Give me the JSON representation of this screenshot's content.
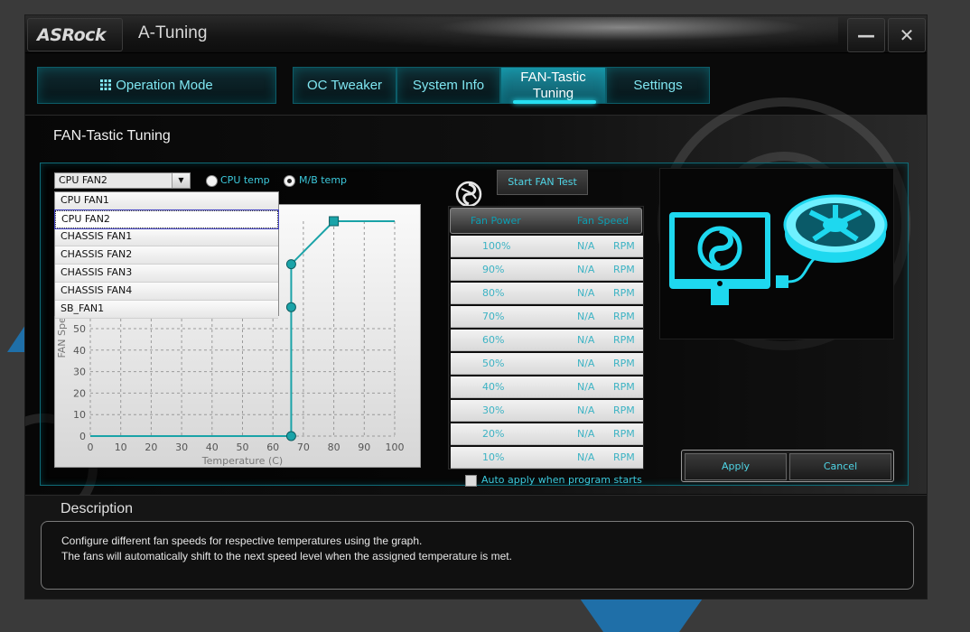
{
  "app": {
    "logo": "ASRock",
    "title": "A-Tuning",
    "minimize_glyph": "—",
    "close_glyph": "✕"
  },
  "nav": {
    "operation_mode": "Operation Mode",
    "oc_tweaker": "OC Tweaker",
    "system_info": "System Info",
    "fan_tastic_line1": "FAN-Tastic",
    "fan_tastic_line2": "Tuning",
    "settings": "Settings",
    "active": "FAN-Tastic Tuning"
  },
  "section": {
    "title": "FAN-Tastic Tuning"
  },
  "fan_select": {
    "value": "CPU FAN2",
    "options": [
      "CPU FAN1",
      "CPU FAN2",
      "CHASSIS FAN1",
      "CHASSIS FAN2",
      "CHASSIS FAN3",
      "CHASSIS FAN4",
      "SB_FAN1"
    ]
  },
  "temp_source": {
    "cpu_label": "CPU temp",
    "mb_label": "M/B temp",
    "selected": "M/B temp"
  },
  "fan_test": {
    "start_label": "Start FAN Test",
    "headers": {
      "power": "Fan Power",
      "speed": "Fan Speed"
    },
    "rows": [
      {
        "power": "100%",
        "speed": "N/A",
        "unit": "RPM"
      },
      {
        "power": "90%",
        "speed": "N/A",
        "unit": "RPM"
      },
      {
        "power": "80%",
        "speed": "N/A",
        "unit": "RPM"
      },
      {
        "power": "70%",
        "speed": "N/A",
        "unit": "RPM"
      },
      {
        "power": "60%",
        "speed": "N/A",
        "unit": "RPM"
      },
      {
        "power": "50%",
        "speed": "N/A",
        "unit": "RPM"
      },
      {
        "power": "40%",
        "speed": "N/A",
        "unit": "RPM"
      },
      {
        "power": "30%",
        "speed": "N/A",
        "unit": "RPM"
      },
      {
        "power": "20%",
        "speed": "N/A",
        "unit": "RPM"
      },
      {
        "power": "10%",
        "speed": "N/A",
        "unit": "RPM"
      }
    ]
  },
  "auto_apply": {
    "label": "Auto apply when program starts",
    "checked": false
  },
  "actions": {
    "apply": "Apply",
    "cancel": "Cancel"
  },
  "description": {
    "title": "Description",
    "line1": "Configure different fan speeds for respective temperatures using the graph.",
    "line2": "The fans will automatically shift to the next speed level when the assigned temperature is met."
  },
  "colors": {
    "accent": "#27e0f2",
    "line": "#1aa3a8",
    "point": "#1aa3a8"
  },
  "chart_data": {
    "type": "line",
    "xlabel": "Temperature (C)",
    "ylabel": "FAN Speed",
    "xlim": [
      0,
      100
    ],
    "ylim": [
      0,
      100
    ],
    "x_ticks": [
      0,
      10,
      20,
      30,
      40,
      50,
      60,
      70,
      80,
      90,
      100
    ],
    "y_ticks": [
      0,
      10,
      20,
      30,
      40,
      50
    ],
    "grid": true,
    "series": [
      {
        "points": [
          [
            0,
            0
          ],
          [
            66,
            0
          ],
          [
            66,
            60
          ],
          [
            66,
            80
          ],
          [
            80,
            100
          ],
          [
            100,
            100
          ]
        ]
      }
    ]
  }
}
